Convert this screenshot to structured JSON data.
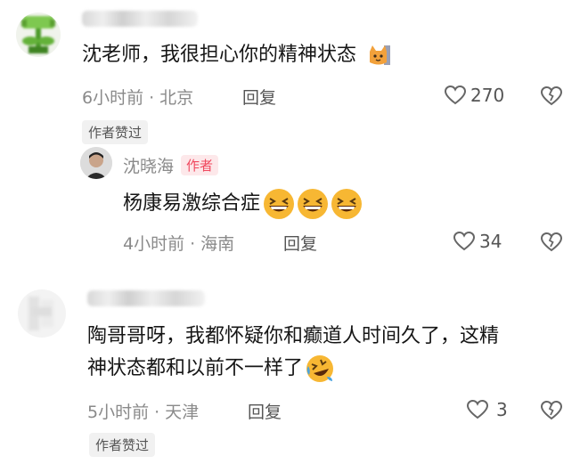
{
  "comments": [
    {
      "text": "沈老师，我很担心你的精神状态",
      "time": "6小时前",
      "location": "北京",
      "reply_label": "回复",
      "likes": "270",
      "author_liked_tag": "作者赞过"
    },
    {
      "text_line1": "陶哥哥呀，我都怀疑你和癫道人时间久了，这精",
      "text_line2": "神状态都和以前不一样了",
      "time": "5小时前",
      "location": "天津",
      "reply_label": "回复",
      "likes": "3",
      "author_liked_tag": "作者赞过"
    }
  ],
  "reply": {
    "username": "沈晓海",
    "author_badge": "作者",
    "text": "杨康易激综合症",
    "time": "4小时前",
    "location": "海南",
    "reply_label": "回复",
    "likes": "34"
  },
  "colors": {
    "author_badge_bg": "#fde8ea",
    "author_badge_text": "#f0485e",
    "meta_gray": "#8a8a8a"
  },
  "icons": [
    "heart-outline-icon",
    "broken-heart-icon",
    "grinning-squint-emoji",
    "rolling-laughing-emoji",
    "cat-emoji"
  ]
}
